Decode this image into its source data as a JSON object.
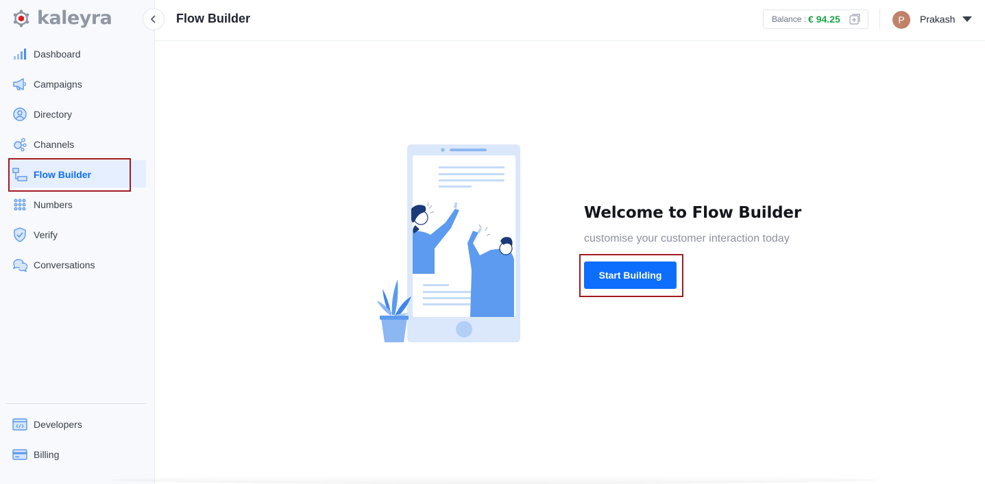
{
  "app": {
    "logo_text": "kaleyra"
  },
  "sidebar": {
    "items": [
      {
        "label": "Dashboard",
        "icon": "bar-chart-icon"
      },
      {
        "label": "Campaigns",
        "icon": "megaphone-icon"
      },
      {
        "label": "Directory",
        "icon": "contact-icon"
      },
      {
        "label": "Channels",
        "icon": "network-icon"
      },
      {
        "label": "Flow Builder",
        "icon": "flow-icon",
        "active": true
      },
      {
        "label": "Numbers",
        "icon": "dialpad-icon"
      },
      {
        "label": "Verify",
        "icon": "shield-icon"
      },
      {
        "label": "Conversations",
        "icon": "chat-bubbles-icon"
      }
    ],
    "bottom_items": [
      {
        "label": "Developers",
        "icon": "code-window-icon"
      },
      {
        "label": "Billing",
        "icon": "credit-card-icon"
      }
    ]
  },
  "header": {
    "title": "Flow Builder",
    "balance_label": "Balance :",
    "balance_value": "€ 94.25",
    "user_initial": "P",
    "user_name": "Prakash"
  },
  "main": {
    "welcome_title": "Welcome to Flow Builder",
    "welcome_subtitle": "customise your customer interaction today",
    "start_button": "Start Building"
  },
  "colors": {
    "accent": "#0d6efd",
    "balance": "#1aa34a",
    "highlight_border": "#a01b22",
    "avatar": "#c0826a"
  }
}
